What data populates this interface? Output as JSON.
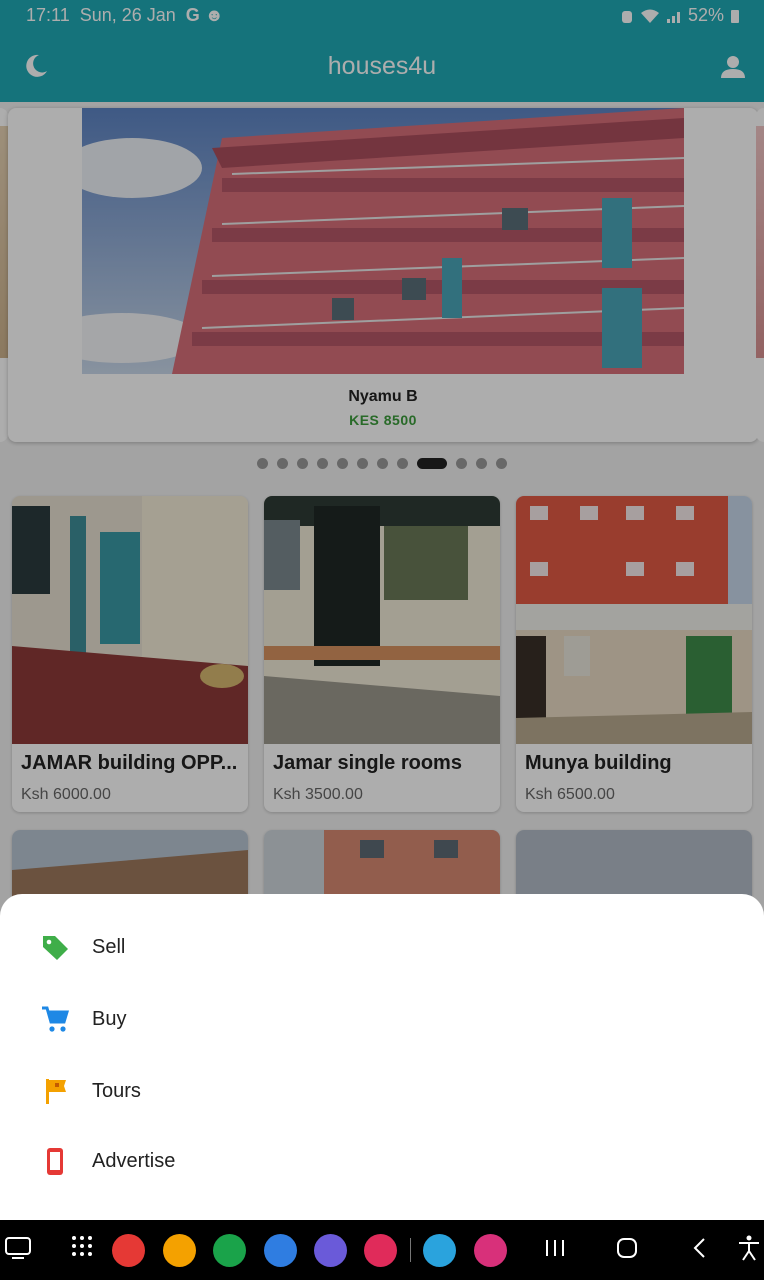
{
  "status": {
    "time": "17:11",
    "date": "Sun, 26 Jan",
    "google_icons": "G ☻",
    "battery": "52%"
  },
  "app": {
    "title": "houses4u"
  },
  "carousel": {
    "featured": {
      "name": "Nyamu B",
      "price": "KES 8500"
    },
    "page_count": 12,
    "active_index": 8
  },
  "listings": [
    {
      "title": "JAMAR building OPP...",
      "price": "Ksh 6000.00"
    },
    {
      "title": "Jamar single rooms",
      "price": "Ksh 3500.00"
    },
    {
      "title": "Munya building",
      "price": "Ksh 6500.00"
    }
  ],
  "sheet": {
    "items": [
      {
        "label": "Sell",
        "icon": "tag-icon",
        "color": "#3fae49"
      },
      {
        "label": "Buy",
        "icon": "cart-icon",
        "color": "#1e88e5"
      },
      {
        "label": "Tours",
        "icon": "flag-icon",
        "color": "#f4a100"
      },
      {
        "label": "Advertise",
        "icon": "phone-icon",
        "color": "#e53935"
      }
    ]
  },
  "colors": {
    "appbar": "#1faab5",
    "price_green": "#3b9c3b"
  }
}
